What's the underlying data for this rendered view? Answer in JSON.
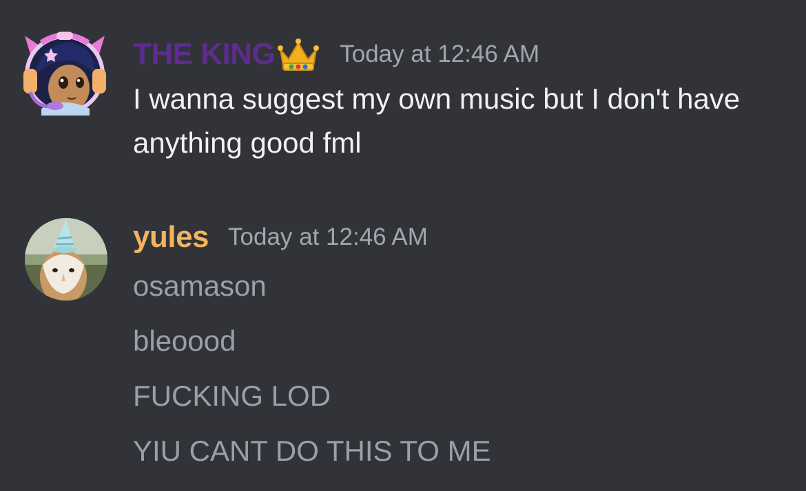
{
  "messages": [
    {
      "username": "THE KING",
      "username_color": "#5d2c8d",
      "badge_icon": "crown-emoji",
      "timestamp": "Today at 12:46 AM",
      "text": "I wanna suggest my own music but I don't have anything good fml"
    },
    {
      "username": "yules",
      "username_color": "#f4b35f",
      "timestamp": "Today at 12:46 AM",
      "lines": [
        "osamason",
        "bleoood",
        "FUCKING LOD",
        "YIU CANT DO THIS TO ME"
      ]
    }
  ]
}
